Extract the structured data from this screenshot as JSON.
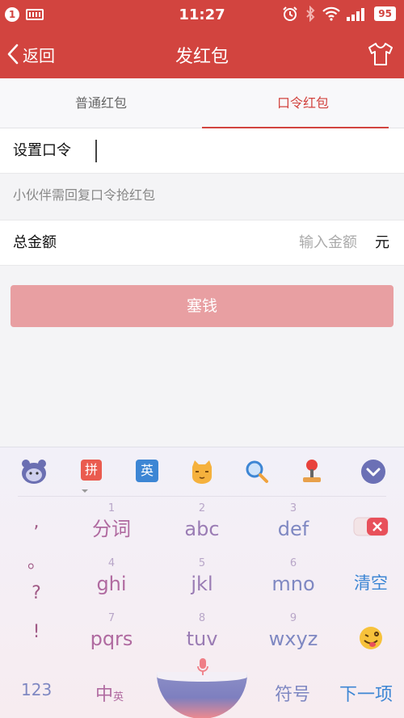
{
  "status_bar": {
    "notification_count": "1",
    "time": "11:27",
    "battery": "95",
    "icons": [
      "notification-badge",
      "keyboard-icon",
      "alarm-icon",
      "bluetooth-icon",
      "wifi-icon",
      "signal-icon",
      "battery-icon"
    ]
  },
  "nav": {
    "back_label": "返回",
    "title": "发红包",
    "right_icon": "shirt-icon"
  },
  "tabs": [
    {
      "label": "普通红包",
      "active": false
    },
    {
      "label": "口令红包",
      "active": true
    }
  ],
  "form": {
    "password_label": "设置口令",
    "password_value": "",
    "hint": "小伙伴需回复口令抢红包",
    "amount_label": "总金额",
    "amount_placeholder": "输入金额",
    "amount_unit": "元",
    "submit_label": "塞钱"
  },
  "keyboard": {
    "toolbar_icons": [
      "mascot-icon",
      "pinyin-icon",
      "english-icon",
      "cat-emoji-icon",
      "search-icon",
      "joystick-icon",
      "collapse-icon"
    ],
    "pinyin_label": "拼",
    "english_label": "英",
    "punctuation": [
      ",",
      "。",
      "?",
      "!"
    ],
    "keys": [
      {
        "num": "1",
        "label": "分词"
      },
      {
        "num": "2",
        "label": "abc"
      },
      {
        "num": "3",
        "label": "def"
      },
      {
        "num": "4",
        "label": "ghi"
      },
      {
        "num": "5",
        "label": "jkl"
      },
      {
        "num": "6",
        "label": "mno"
      },
      {
        "num": "7",
        "label": "pqrs"
      },
      {
        "num": "8",
        "label": "tuv"
      },
      {
        "num": "9",
        "label": "wxyz"
      }
    ],
    "clear_label": "清空",
    "bottom": {
      "numbers_label": "123",
      "lang_main": "中",
      "lang_sub": "英",
      "symbols_label": "符号",
      "next_label": "下一项"
    },
    "colors": {
      "accent": "#d2443f",
      "key_pink": "#b06aa0",
      "key_purple": "#9a7cb4",
      "key_blue": "#7f88c2"
    }
  }
}
